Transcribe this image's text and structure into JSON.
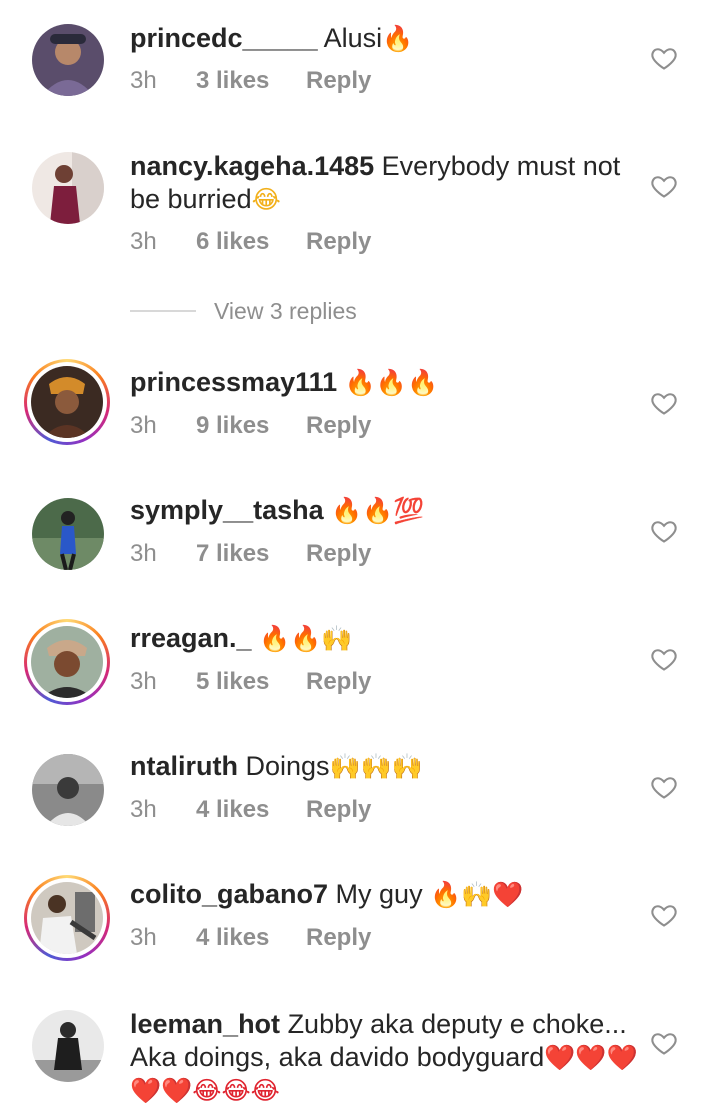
{
  "comments": [
    {
      "username": "princedc_____",
      "text": "Alusi",
      "emojis": "🔥",
      "time": "3h",
      "likes": "3 likes",
      "reply": "Reply"
    },
    {
      "username": "nancy.kageha.1485",
      "text": "Everybody must not be burried",
      "emojis": "😂",
      "time": "3h",
      "likes": "6 likes",
      "reply": "Reply"
    },
    {
      "username": "princessmay111",
      "text": "",
      "emojis": "🔥🔥🔥",
      "time": "3h",
      "likes": "9 likes",
      "reply": "Reply"
    },
    {
      "username": "symply__tasha",
      "text": "",
      "emojis": "🔥🔥💯",
      "time": "3h",
      "likes": "7 likes",
      "reply": "Reply"
    },
    {
      "username": "rreagan._",
      "text": "",
      "emojis": "🔥🔥🙌",
      "time": "3h",
      "likes": "5 likes",
      "reply": "Reply"
    },
    {
      "username": "ntaliruth",
      "text": "Doings",
      "emojis": "🙌🙌🙌",
      "time": "3h",
      "likes": "4 likes",
      "reply": "Reply"
    },
    {
      "username": "colito_gabano7",
      "text": "My guy",
      "emojis": "🔥🙌❤️",
      "time": "3h",
      "likes": "4 likes",
      "reply": "Reply"
    },
    {
      "username": "leeman_hot",
      "text": "Zubby aka deputy e choke... Aka doings, aka davido bodyguard",
      "emojis": "❤️❤️❤️❤️❤️😂😂😂",
      "time": "",
      "likes": "",
      "reply": ""
    }
  ],
  "view_replies": "View 3 replies",
  "icons": {
    "like": "heart-outline-icon"
  },
  "colors": {
    "text": "#262626",
    "meta": "#8e8e8e",
    "story_ring": "#d62976"
  }
}
